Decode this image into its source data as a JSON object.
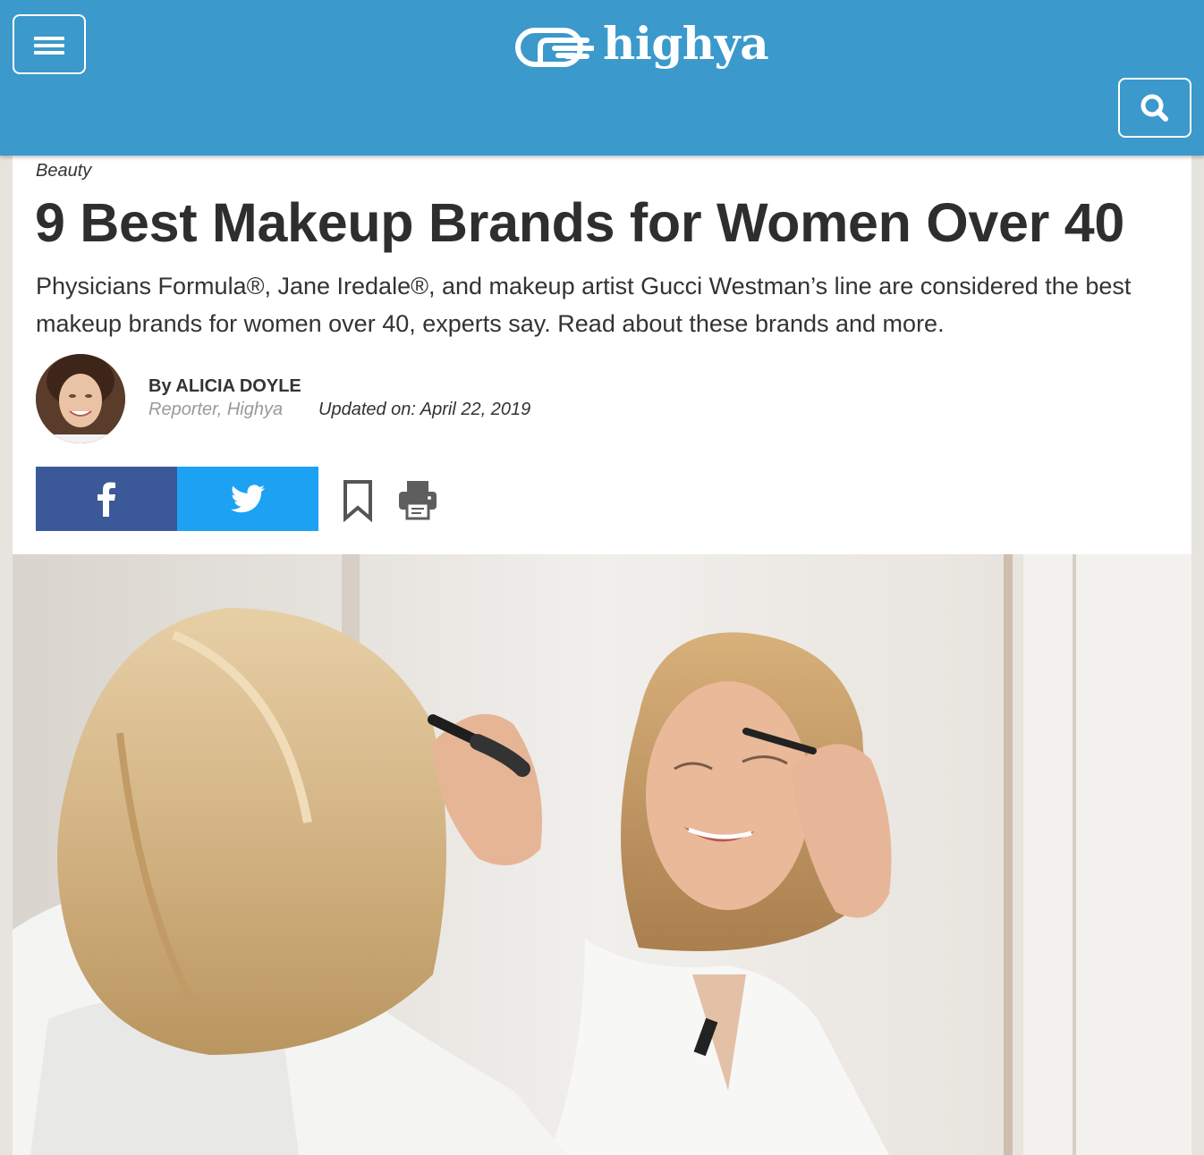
{
  "header": {
    "brand": "highya",
    "menu_icon": "hamburger-menu-icon",
    "search_icon": "search-icon",
    "color": "#3b99cb"
  },
  "article": {
    "category": "Beauty",
    "title": "9 Best Makeup Brands for Women Over 40",
    "subtitle": "Physicians Formula®, Jane Iredale®, and makeup artist Gucci Westman’s line are considered the best makeup brands for women over 40, experts say. Read about these brands and more.",
    "author": {
      "byline": "By ALICIA DOYLE",
      "role": "Reporter, Highya"
    },
    "updated": "Updated on: April 22, 2019"
  },
  "share": {
    "facebook_icon": "facebook-icon",
    "facebook_color": "#3b5998",
    "twitter_icon": "twitter-icon",
    "twitter_color": "#1da1f2",
    "bookmark_icon": "bookmark-icon",
    "print_icon": "printer-icon"
  },
  "hero_image": {
    "subject": "woman applying mascara in a mirror"
  }
}
